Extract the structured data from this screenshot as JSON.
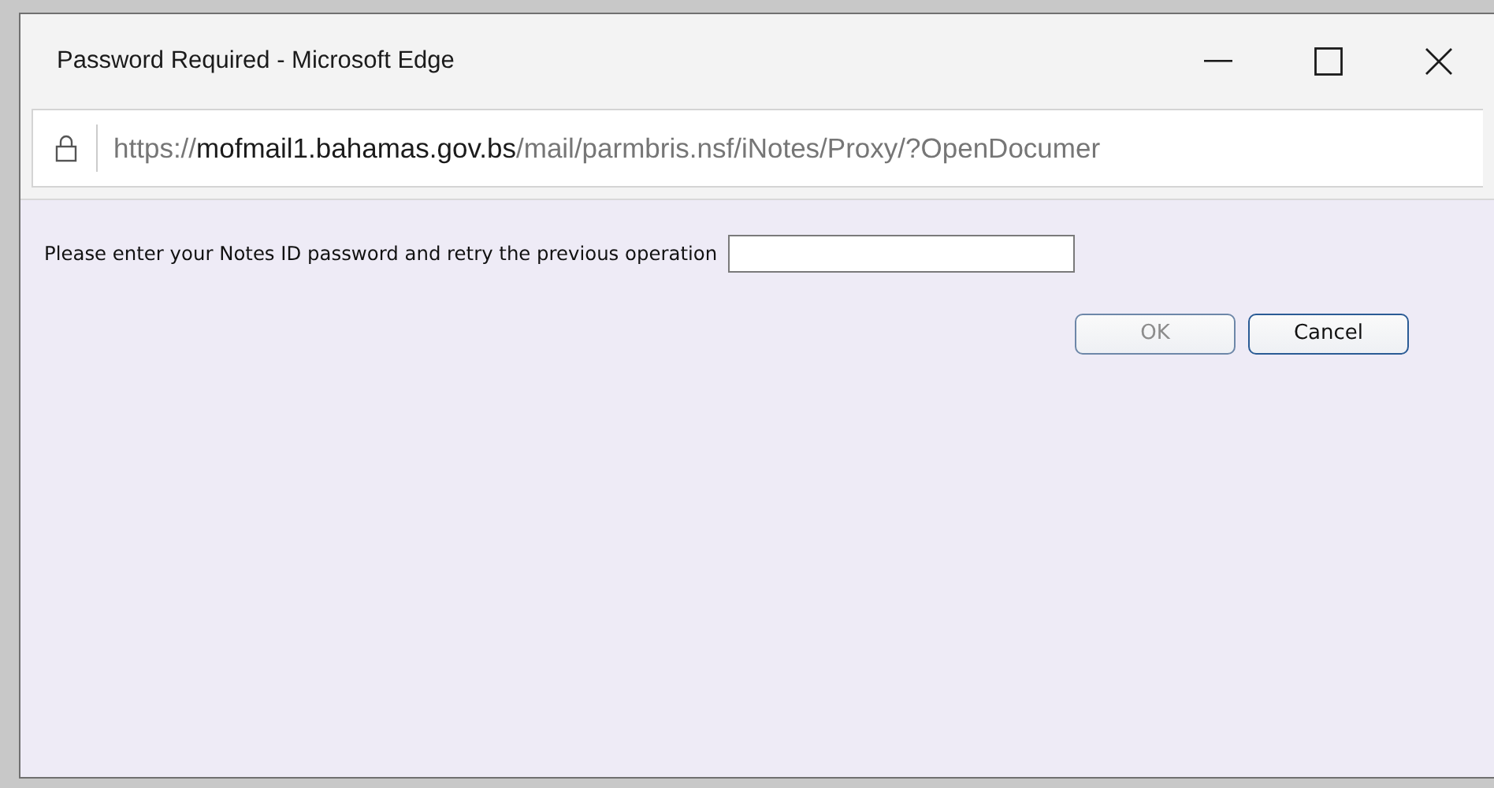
{
  "window": {
    "title": "Password Required - Microsoft Edge"
  },
  "address_bar": {
    "scheme": "https://",
    "host": "mofmail1.bahamas.gov.bs",
    "path": "/mail/parmbris.nsf/iNotes/Proxy/?OpenDocumer"
  },
  "prompt": "Please enter your Notes ID password and retry the previous operation",
  "buttons": [
    {
      "label": "OK",
      "disabled": true
    },
    {
      "label": "Cancel",
      "disabled": false
    }
  ]
}
